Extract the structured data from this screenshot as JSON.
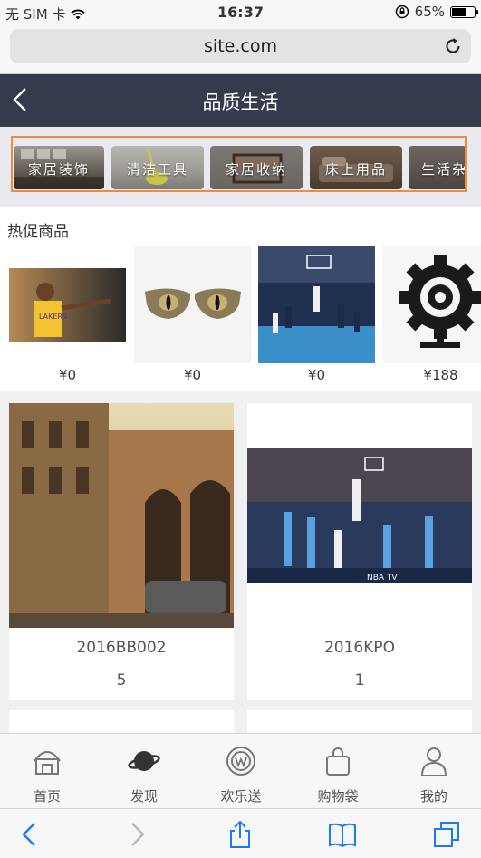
{
  "status_bar": {
    "carrier": "无 SIM 卡",
    "time": "16:37",
    "battery": "65%",
    "battery_level": 0.65
  },
  "browser": {
    "url": "site.com"
  },
  "header": {
    "title": "品质生活"
  },
  "categories": [
    "家居装饰",
    "清洁工具",
    "家居收纳",
    "床上用品",
    "生活杂货"
  ],
  "hot": {
    "title": "热促商品",
    "products": [
      {
        "image": "basketball-player-photo",
        "price": "¥0"
      },
      {
        "image": "cat-eye-glasses-photo",
        "price": "¥0"
      },
      {
        "image": "basketball-game-photo",
        "price": "¥0"
      },
      {
        "image": "gear-sculpture-photo",
        "price": "¥188"
      }
    ]
  },
  "grid": [
    {
      "image": "street-photo",
      "name": "2016BB002",
      "count": "5"
    },
    {
      "image": "nba-dunk-photo",
      "name": "2016KPO",
      "count": "1"
    }
  ],
  "tabs": [
    {
      "label": "首页",
      "icon": "home-icon"
    },
    {
      "label": "发现",
      "icon": "discover-icon"
    },
    {
      "label": "欢乐送",
      "icon": "gift-icon"
    },
    {
      "label": "购物袋",
      "icon": "bag-icon"
    },
    {
      "label": "我的",
      "icon": "user-icon"
    }
  ],
  "colors": {
    "header_bg": "#353b4c",
    "category_frame": "#f08a3c"
  }
}
